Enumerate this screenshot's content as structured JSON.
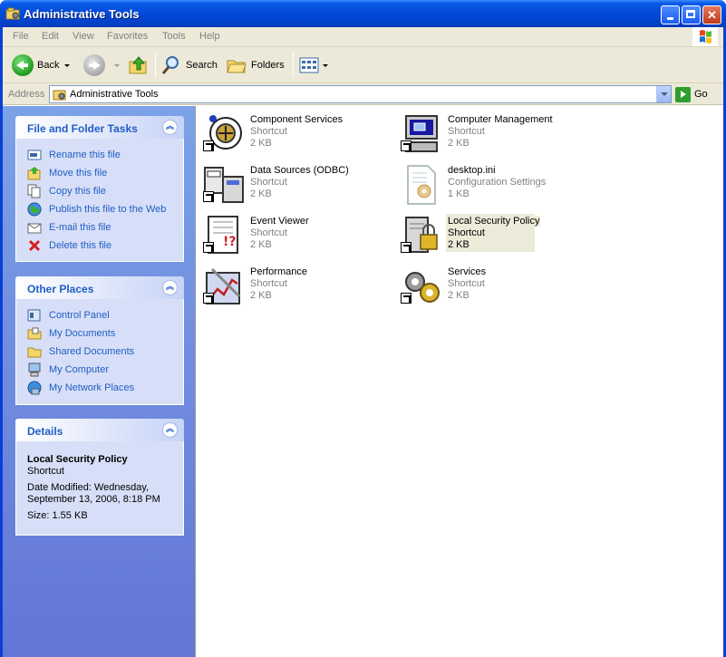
{
  "window": {
    "title": "Administrative Tools"
  },
  "menu": [
    "File",
    "Edit",
    "View",
    "Favorites",
    "Tools",
    "Help"
  ],
  "toolbar": {
    "back_label": "Back",
    "search_label": "Search",
    "folders_label": "Folders"
  },
  "address": {
    "label": "Address",
    "value": "Administrative Tools",
    "go_label": "Go"
  },
  "file_tasks": {
    "title": "File and Folder Tasks",
    "items": [
      {
        "label": "Rename this file",
        "icon": "rename-icon"
      },
      {
        "label": "Move this file",
        "icon": "move-icon"
      },
      {
        "label": "Copy this file",
        "icon": "copy-icon"
      },
      {
        "label": "Publish this file to the Web",
        "icon": "publish-icon"
      },
      {
        "label": "E-mail this file",
        "icon": "email-icon"
      },
      {
        "label": "Delete this file",
        "icon": "delete-icon"
      }
    ]
  },
  "other_places": {
    "title": "Other Places",
    "items": [
      {
        "label": "Control Panel",
        "icon": "control-panel-icon"
      },
      {
        "label": "My Documents",
        "icon": "my-documents-icon"
      },
      {
        "label": "Shared Documents",
        "icon": "shared-documents-icon"
      },
      {
        "label": "My Computer",
        "icon": "my-computer-icon"
      },
      {
        "label": "My Network Places",
        "icon": "my-network-places-icon"
      }
    ]
  },
  "details": {
    "title": "Details",
    "name": "Local Security Policy",
    "type": "Shortcut",
    "date_modified": "Date Modified: Wednesday, September 13, 2006, 8:18 PM",
    "size": "Size: 1.55 KB"
  },
  "files": [
    {
      "name": "Component Services",
      "type": "Shortcut",
      "size": "2 KB",
      "icon": "component-services-icon"
    },
    {
      "name": "Computer Management",
      "type": "Shortcut",
      "size": "2 KB",
      "icon": "computer-management-icon"
    },
    {
      "name": "Data Sources (ODBC)",
      "type": "Shortcut",
      "size": "2 KB",
      "icon": "data-sources-icon"
    },
    {
      "name": "desktop.ini",
      "type": "Configuration Settings",
      "size": "1 KB",
      "icon": "settings-file-icon"
    },
    {
      "name": "Event Viewer",
      "type": "Shortcut",
      "size": "2 KB",
      "icon": "event-viewer-icon"
    },
    {
      "name": "Local Security Policy",
      "type": "Shortcut",
      "size": "2 KB",
      "icon": "security-policy-icon"
    },
    {
      "name": "Performance",
      "type": "Shortcut",
      "size": "2 KB",
      "icon": "performance-icon"
    },
    {
      "name": "Services",
      "type": "Shortcut",
      "size": "2 KB",
      "icon": "services-icon"
    }
  ]
}
